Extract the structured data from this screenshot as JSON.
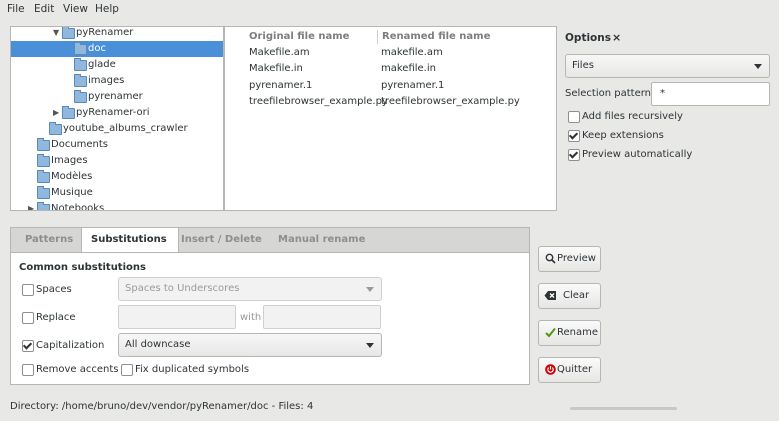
{
  "menubar": {
    "file": "File",
    "edit": "Edit",
    "view": "View",
    "help": "Help"
  },
  "tree": {
    "items": [
      {
        "label": "pyRenamer",
        "arrow": "▼"
      },
      {
        "label": "doc"
      },
      {
        "label": "glade"
      },
      {
        "label": "images"
      },
      {
        "label": "pyrenamer"
      },
      {
        "label": "pyRenamer-ori",
        "arrow": "▶"
      },
      {
        "label": "youtube_albums_crawler"
      },
      {
        "label": "Documents"
      },
      {
        "label": "Images"
      },
      {
        "label": "Modèles"
      },
      {
        "label": "Musique"
      },
      {
        "label": "Notebooks",
        "arrow": "▶"
      }
    ]
  },
  "filelist": {
    "col_original": "Original file name",
    "col_renamed": "Renamed file name",
    "rows": [
      {
        "original": "Makefile.am",
        "renamed": "makefile.am"
      },
      {
        "original": "Makefile.in",
        "renamed": "makefile.in"
      },
      {
        "original": "pyrenamer.1",
        "renamed": "pyrenamer.1"
      },
      {
        "original": "treefilebrowser_example.py",
        "renamed": "treefilebrowser_example.py"
      }
    ]
  },
  "options": {
    "title": "Options",
    "close": "×",
    "scope": "Files",
    "selection_label": "Selection pattern",
    "selection_value": "*",
    "add_recursive": "Add files recursively",
    "keep_ext": "Keep extensions",
    "preview_auto": "Preview automatically"
  },
  "tabs": {
    "patterns": "Patterns",
    "substitutions": "Substitutions",
    "insert_delete": "Insert / Delete",
    "manual": "Manual rename"
  },
  "subs": {
    "heading": "Common substitutions",
    "spaces_label": "Spaces",
    "spaces_value": "Spaces to Underscores",
    "replace_label": "Replace",
    "with_label": "with",
    "cap_label": "Capitalization",
    "cap_value": "All downcase",
    "accents_label": "Remove accents",
    "dup_label": "Fix duplicated symbols"
  },
  "buttons": {
    "preview": "Preview",
    "clear": "Clear",
    "rename": "Rename",
    "quit": "Quitter"
  },
  "status": {
    "text": "Directory: /home/bruno/dev/vendor/pyRenamer/doc - Files: 4"
  }
}
